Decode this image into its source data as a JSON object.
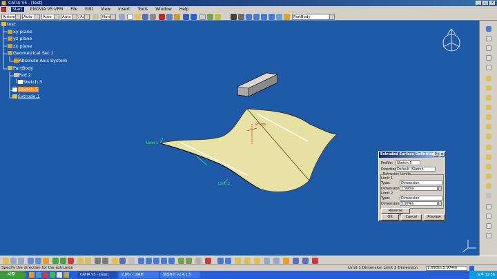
{
  "window": {
    "title": "CATIA V5 - [test]"
  },
  "menubar": {
    "items": [
      "Start",
      "ENOVIA V5 VPM",
      "File",
      "Edit",
      "View",
      "Insert",
      "Tools",
      "Window",
      "Help"
    ]
  },
  "toolbar": {
    "combo_1": "Automa",
    "combo_2": "Auto",
    "combo_3": "Auto",
    "combo_4": "Auto",
    "combo_5": "Aut",
    "combo_6": "None",
    "part_combo": "PartBody"
  },
  "tree": {
    "root": "test",
    "xy_plane": "xy plane",
    "yz_plane": "yz plane",
    "zx_plane": "zx plane",
    "geo_set": "Geometrical Set.1",
    "axis_system": "Absolute Axis System",
    "partbody": "PartBody",
    "pad": "Pad.2",
    "sketch3": "Sketch.3",
    "sketch5": "Sketch.5",
    "extrude": "Extrude.1"
  },
  "viewport_labels": {
    "limit1": "Limit 1",
    "limit2": "Limit 2",
    "profile": "Profile"
  },
  "dialog": {
    "title": "Extruded Surface Definition",
    "profile_label": "Profile:",
    "profile_value": "Sketch.5",
    "direction_label": "Direction:",
    "direction_value": "Default (Sketch normal)",
    "extrusion_limits": "Extrusion Limits",
    "limit1_label": "Limit 1",
    "type1_label": "Type:",
    "type1_value": "Dimension",
    "dim1_label": "Dimension:",
    "dim1_value": "1.993in",
    "limit2_label": "Limit 2",
    "type2_label": "Type:",
    "type2_value": "Dimension",
    "dim2_label": "Dimension:",
    "dim2_value": "5.974in",
    "reverse_label": "Reverse Direction",
    "ok_label": "OK",
    "cancel_label": "Cancel",
    "preview_label": "Preview"
  },
  "status": {
    "left": "Specify the direction for the extrusion",
    "right_label": "Limit 1 Dimension Limit 2 Dimension",
    "right_value": "1.993in,5.974in"
  },
  "taskbar": {
    "start": "시작",
    "tasks": [
      "CATIA V5 - [test]",
      "2.JPG - 그림판",
      "알집뷰어 v2.4.1.5"
    ],
    "clock": "오후 12:56"
  },
  "colors": {
    "viewport_bg": "#1f5aa8",
    "surface": "#e8e2a6",
    "selection": "#f08a24",
    "dialog_title": "#0a246a"
  }
}
